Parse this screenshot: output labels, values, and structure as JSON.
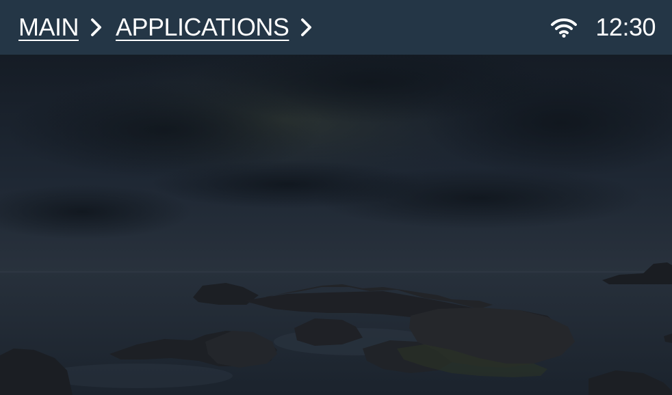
{
  "breadcrumb": {
    "items": [
      {
        "label": "MAIN"
      },
      {
        "label": "APPLICATIONS"
      }
    ]
  },
  "status": {
    "time": "12:30",
    "wifi_icon": "wifi-icon"
  },
  "colors": {
    "topbar": "#243646",
    "text": "#ffffff"
  }
}
